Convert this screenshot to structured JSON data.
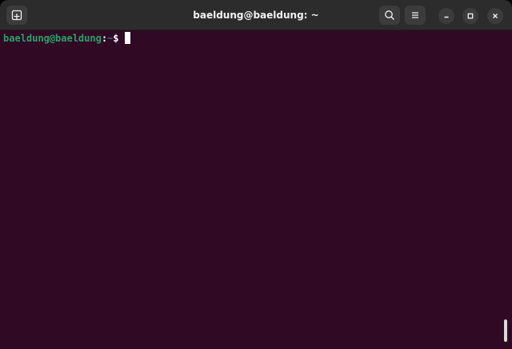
{
  "window": {
    "title": "baeldung@baeldung: ~"
  },
  "toolbar": {
    "new_tab_icon": "new-tab-icon",
    "search_icon": "search-icon",
    "menu_icon": "hamburger-menu-icon"
  },
  "window_controls": {
    "minimize_icon": "minimize-icon",
    "maximize_icon": "maximize-icon",
    "close_icon": "close-icon"
  },
  "terminal": {
    "prompt_user_host": "baeldung@baeldung",
    "prompt_separator": ":",
    "prompt_cwd": "~",
    "prompt_symbol": "$"
  },
  "colors": {
    "terminal_background": "#300a24",
    "titlebar_background": "#2c2c2c",
    "prompt_user_host": "#26a269",
    "prompt_cwd": "#3465a4"
  }
}
